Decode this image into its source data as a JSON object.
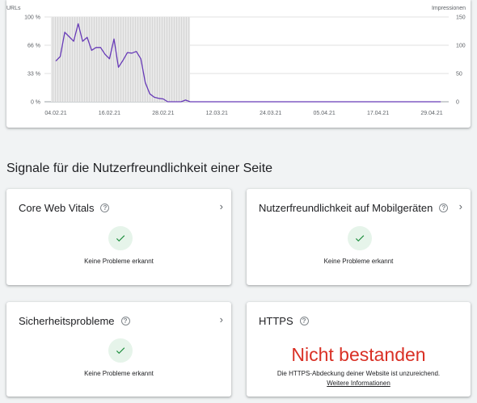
{
  "chart_data": {
    "type": "line",
    "left_axis_title": "URLs",
    "right_axis_title": "Impressionen",
    "left_ticks": [
      "100 %",
      "66 %",
      "33 %",
      "0 %"
    ],
    "right_ticks": [
      "150",
      "100",
      "50",
      "0"
    ],
    "x_ticks": [
      "04.02.21",
      "16.02.21",
      "28.02.21",
      "12.03.21",
      "24.03.21",
      "05.04.21",
      "17.04.21",
      "29.04.21"
    ],
    "x_tick_dates": [
      "2021-02-04",
      "2021-02-16",
      "2021-02-28",
      "2021-03-12",
      "2021-03-24",
      "2021-04-05",
      "2021-04-17",
      "2021-04-29"
    ],
    "shaded_range": [
      "2021-02-04",
      "2021-03-06"
    ],
    "ylim_left": [
      0,
      100
    ],
    "ylim_right": [
      0,
      150
    ],
    "series": [
      {
        "axis": "right",
        "color": "#673ab7",
        "x": [
          "2021-02-04",
          "2021-02-05",
          "2021-02-06",
          "2021-02-07",
          "2021-02-08",
          "2021-02-09",
          "2021-02-10",
          "2021-02-11",
          "2021-02-12",
          "2021-02-13",
          "2021-02-14",
          "2021-02-15",
          "2021-02-16",
          "2021-02-17",
          "2021-02-18",
          "2021-02-19",
          "2021-02-20",
          "2021-02-21",
          "2021-02-22",
          "2021-02-23",
          "2021-02-24",
          "2021-02-25",
          "2021-02-26",
          "2021-02-27",
          "2021-02-28",
          "2021-03-01",
          "2021-03-02",
          "2021-03-03",
          "2021-03-04",
          "2021-03-05",
          "2021-03-06",
          "2021-05-01"
        ],
        "values": [
          72,
          80,
          123,
          115,
          107,
          138,
          107,
          114,
          91,
          96,
          96,
          84,
          76,
          111,
          61,
          73,
          87,
          86,
          89,
          76,
          34,
          14,
          8,
          6,
          5,
          0,
          0,
          0,
          0,
          3,
          0,
          0
        ]
      }
    ]
  },
  "section_title": "Signale für die Nutzerfreundlichkeit einer Seite",
  "cards": {
    "core_web_vitals": {
      "title": "Core Web Vitals",
      "status": "Keine Probleme erkannt"
    },
    "mobile": {
      "title": "Nutzerfreundlichkeit auf Mobilgeräten",
      "status": "Keine Probleme erkannt"
    },
    "security": {
      "title": "Sicherheitsprobleme",
      "status": "Keine Probleme erkannt"
    },
    "https": {
      "title": "HTTPS",
      "result": "Nicht bestanden",
      "detail": "Die HTTPS-Abdeckung deiner Website ist unzureichend.",
      "link": "Weitere Informationen"
    }
  },
  "colors": {
    "success_bg": "#e6f4ea",
    "success_check": "#1e8e3e",
    "fail": "#d93025",
    "series": "#673ab7"
  },
  "icons": {
    "help": "help-circle-icon",
    "chevron": "chevron-right-icon",
    "check": "check-icon"
  }
}
